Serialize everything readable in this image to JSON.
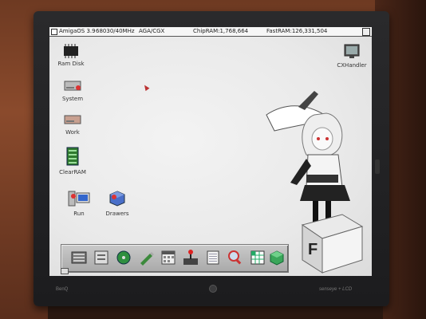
{
  "menubar": {
    "os": "AmigaOS 3.9",
    "cpu": "68030/40MHz",
    "chipset": "AGA/CGX",
    "chipram": "ChipRAM:1,768,664",
    "fastram": "FastRAM:126,331,504"
  },
  "desktop_icons": [
    {
      "name": "Ram Disk",
      "icon": "ram-chip-icon"
    },
    {
      "name": "System",
      "icon": "hard-drive-icon"
    },
    {
      "name": "Work",
      "icon": "hard-drive-icon"
    },
    {
      "name": "ClearRAM",
      "icon": "circuit-board-icon"
    },
    {
      "name": "Run",
      "icon": "computer-icon"
    },
    {
      "name": "Drawers",
      "icon": "cubes-icon"
    },
    {
      "name": "CXHandler",
      "icon": "monitor-icon"
    }
  ],
  "dock_items": [
    "tower-icon",
    "document-icon",
    "disk-icon",
    "pen-icon",
    "calendar-icon",
    "joystick-icon",
    "notes-icon",
    "magnifier-icon",
    "grid-icon",
    "cube-icon"
  ],
  "wallpaper_letter": "F",
  "bezel": {
    "left_logo": "BenQ",
    "right_brand": "senseye + LCD"
  },
  "colors": {
    "screen_bg": "#ececec",
    "menubar_bg": "#f6f6f6",
    "bezel": "#1e1e20"
  }
}
